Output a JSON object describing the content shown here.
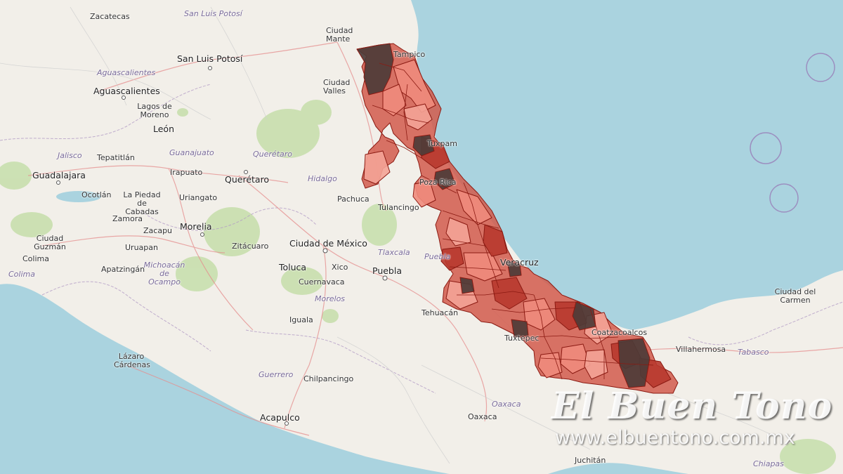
{
  "map": {
    "colors": {
      "water": "#aad3df",
      "land": "#f2efe9",
      "forest": "#add19e",
      "roads": "#f4b9b0",
      "region_fill_light": "#f07a6a",
      "region_fill_mid": "#c9463a",
      "region_fill_dark": "#4a3633",
      "region_stroke": "#8b1a12"
    },
    "labels": {
      "zacatecas": "Zacatecas",
      "san_luis_potosi_state": "San Luis Potosí",
      "san_luis_potosi": "San Luis Potosí",
      "ciudad_mante": "Ciudad Mante",
      "tampico": "Tampico",
      "aguascalientes_state": "Aguascalientes",
      "aguascalientes": "Aguascalientes",
      "lagos_de_moreno": "Lagos de Moreno",
      "ciudad_valles": "Ciudad Valles",
      "leon": "León",
      "guanajuato": "Guanajuato",
      "queretaro_state": "Querétaro",
      "tuxpam": "Tuxpam",
      "jalisco": "Jalisco",
      "tepatitlan": "Tepatitlán",
      "guadalajara": "Guadalajara",
      "irapuato": "Irapuato",
      "queretaro": "Querétaro",
      "hidalgo": "Hidalgo",
      "poza_rica": "Poza Rica",
      "ocotlan": "Ocotlán",
      "la_piedad": "La Piedad de Cabadas",
      "uriangato": "Uriangato",
      "pachuca": "Pachuca",
      "tulancingo": "Tulancingo",
      "zamora": "Zamora",
      "zacapu": "Zacapu",
      "morelia": "Morelia",
      "ciudad_guzman": "Ciudad Guzmán",
      "uruapan": "Uruapan",
      "zitacuaro": "Zitácuaro",
      "ciudad_de_mexico": "Ciudad de México",
      "tlaxcala": "Tlaxcala",
      "colima_state": "Colima",
      "colima": "Colima",
      "apatzingan": "Apatzingán",
      "michoacan": "Michoacán de Ocampo",
      "toluca": "Toluca",
      "xico": "Xico",
      "puebla": "Puebla",
      "puebla_state": "Puebla",
      "veracruz": "Veracruz",
      "cuernavaca": "Cuernavaca",
      "morelos": "Morelos",
      "ciudad_del_carmen": "Ciudad del Carmen",
      "tehuacan": "Tehuacán",
      "iguala": "Iguala",
      "coatzacoalcos": "Coatzacoalcos",
      "tuxtepec": "Tuxtepec",
      "villahermosa": "Villahermosa",
      "tabasco": "Tabasco",
      "lazaro_cardenas": "Lázaro Cárdenas",
      "guerrero": "Guerrero",
      "chilpancingo": "Chilpancingo",
      "oaxaca_state": "Oaxaca",
      "acapulco": "Acapulco",
      "oaxaca": "Oaxaca",
      "juchitan": "Juchitán",
      "chiapas": "Chiapas"
    }
  },
  "watermark": {
    "title": "El Buen Tono",
    "url": "www.elbuentono.com.mx"
  }
}
